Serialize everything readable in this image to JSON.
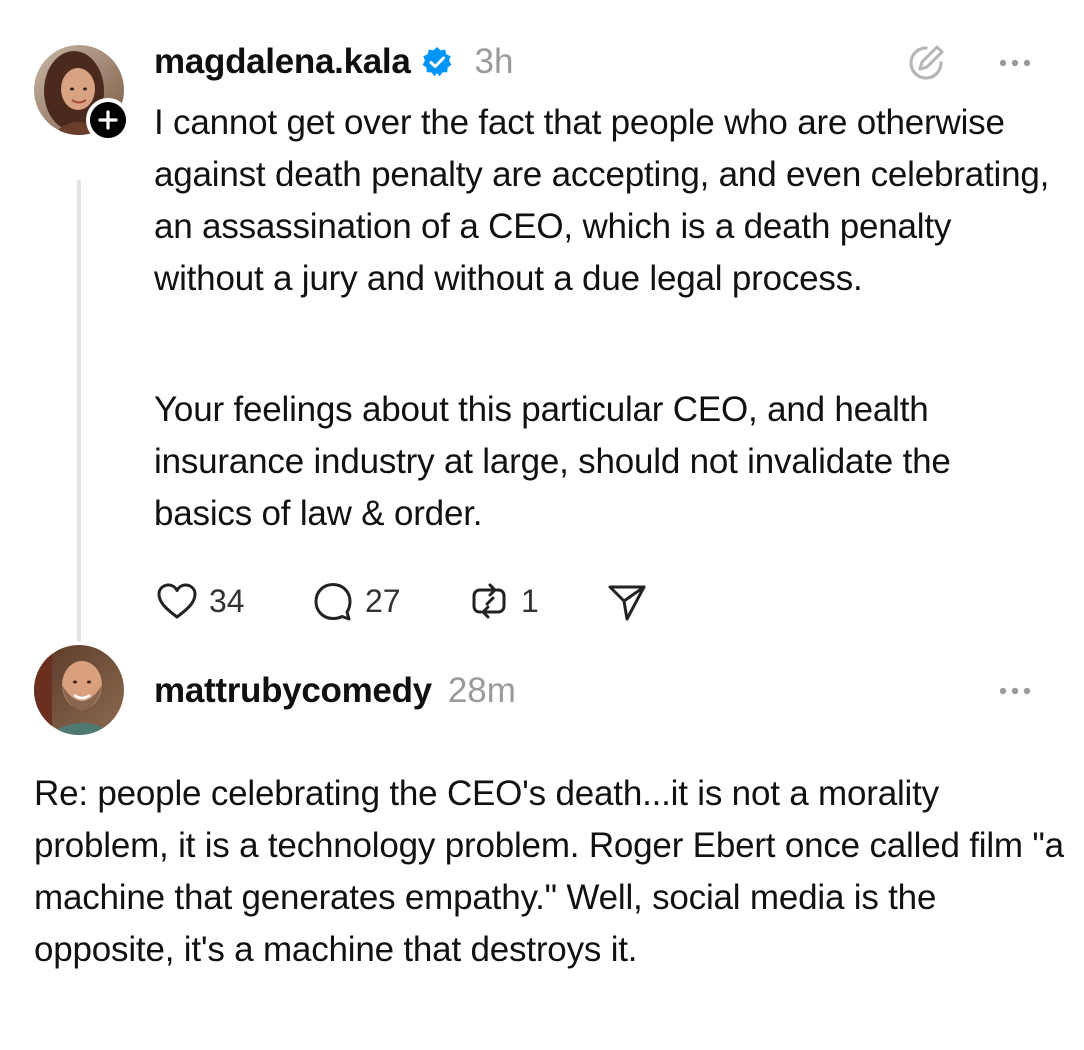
{
  "post": {
    "username": "magdalena.kala",
    "timestamp": "3h",
    "paragraphs": [
      "I cannot get over the fact that people who are otherwise against death penalty are accepting, and even celebrating, an assassination of a CEO, which is a death penalty without a jury and without a due legal process.",
      "Your feelings about this particular CEO, and health insurance industry at large, should not invalidate the basics of law & order."
    ],
    "likes": "34",
    "replies": "27",
    "reposts": "1",
    "icons": [
      "verified-icon",
      "edit-icon",
      "more-icon",
      "heart-icon",
      "comment-icon",
      "repost-icon",
      "share-icon",
      "follow-plus-icon"
    ]
  },
  "reply": {
    "username": "mattrubycomedy",
    "timestamp": "28m",
    "text": "Re: people celebrating the CEO's death...it is not a morality problem, it is a technology problem. Roger Ebert once called film \"a machine that generates empathy.\" Well, social media is the opposite, it's a machine that destroys it."
  },
  "colors": {
    "verified": "#0095f6",
    "muted": "#9a9a9a",
    "thread_line": "#e2e2e2"
  }
}
